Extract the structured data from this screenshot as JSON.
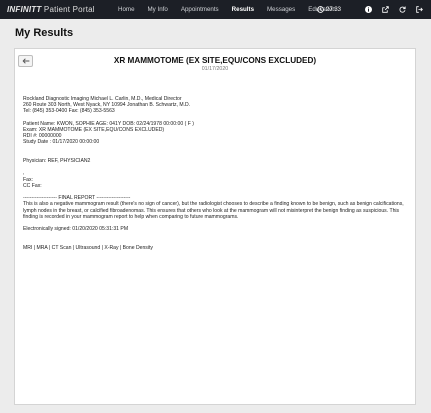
{
  "brand": {
    "part1": "INFINITT",
    "part2": "Patient Portal"
  },
  "nav": [
    {
      "label": "Home",
      "active": false
    },
    {
      "label": "My Info",
      "active": false
    },
    {
      "label": "Appointments",
      "active": false
    },
    {
      "label": "Results",
      "active": true
    },
    {
      "label": "Messages",
      "active": false
    },
    {
      "label": "Education",
      "active": false
    }
  ],
  "session_timer": "27:33",
  "page_title": "My Results",
  "report": {
    "title": "XR MAMMOTOME (EX SITE,EQU/CONS EXCLUDED)",
    "date": "01/17/2020",
    "facility_line1": "Rockland Diagnostic Imaging Michael L. Carlin, M.D., Medical Director",
    "facility_line2": "260 Route 303 North, West Nyack, NY 10994 Jonathan B. Schwartz, M.D.",
    "facility_line3": "Tel: (845) 353-0400 Fax: (845) 353-5563",
    "patient_line": "Patient Name: KWON, SOPHIE AGE: 041Y DOB: 02/24/1978 00:00:00 ( F )",
    "exam_line": "Exam: XR MAMMOTOME (EX SITE,EQU/CONS EXCLUDED)",
    "rdi_line": "RDI #: 00000000",
    "study_date_line": "Study Date : 01/17/2020 00:00:00",
    "physician_line": "Physician: REF, PHYSICIAN2",
    "blank_dot": ",",
    "fax_line": "Fax:",
    "cc_fax_line": "CC Fax:",
    "final_report_header": "-------------------- FINAL REPORT --------------------",
    "findings": "This is also a negative mammogram result (there's no sign of cancer), but the radiologist chooses to describe a finding known to be benign, such as benign calcifications, lymph nodes in the breast, or calcified fibroadenomas. This ensures that others who look at the mammogram will not misinterpret the benign finding as suspicious. This finding is recorded in your mammogram report to help when comparing to future mammograms.",
    "signed_line": "Electronically signed: 01/20/2020 05:31:31 PM",
    "modalities_line": "MRI | MRA | CT Scan | Ultrasound | X-Ray | Bone Density"
  },
  "colors": {
    "topbar": "#1c1f26",
    "background": "#ececec",
    "card": "#ffffff"
  },
  "icons": [
    "clock-icon",
    "info-icon",
    "external-link-icon",
    "refresh-icon",
    "logout-icon",
    "arrow-left-icon"
  ]
}
